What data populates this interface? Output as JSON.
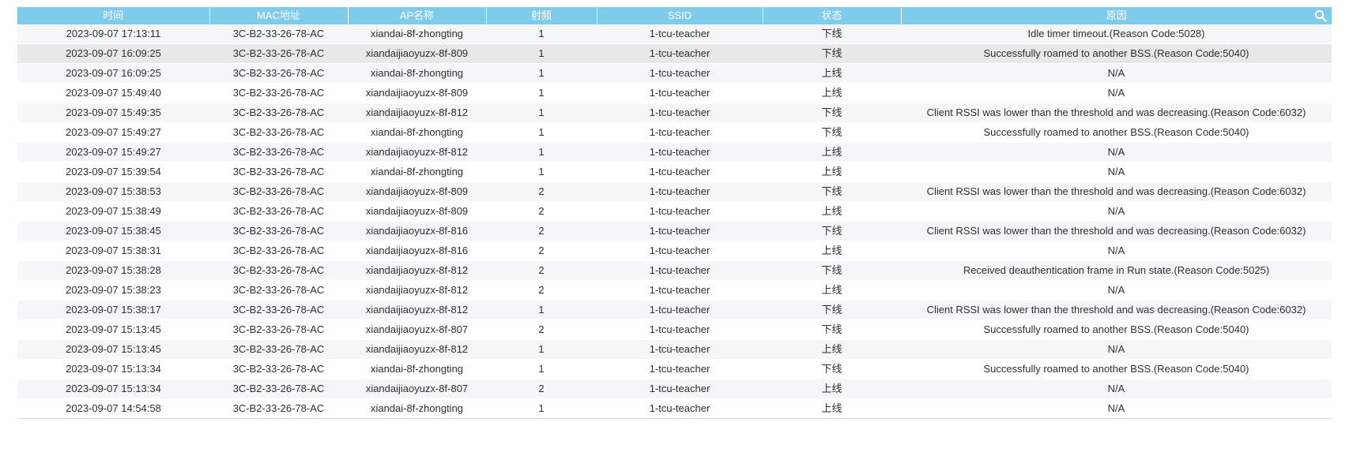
{
  "table": {
    "columns": [
      "时间",
      "MAC地址",
      "AP名称",
      "射频",
      "SSID",
      "状态",
      "原因"
    ],
    "search_icon": "search-icon",
    "rows": [
      [
        "2023-09-07 17:13:11",
        "3C-B2-33-26-78-AC",
        "xiandai-8f-zhongting",
        "1",
        "1-tcu-teacher",
        "下线",
        "Idle timer timeout.(Reason Code:5028)"
      ],
      [
        "2023-09-07 16:09:25",
        "3C-B2-33-26-78-AC",
        "xiandaijiaoyuzx-8f-809",
        "1",
        "1-tcu-teacher",
        "下线",
        "Successfully roamed to another BSS.(Reason Code:5040)"
      ],
      [
        "2023-09-07 16:09:25",
        "3C-B2-33-26-78-AC",
        "xiandai-8f-zhongting",
        "1",
        "1-tcu-teacher",
        "上线",
        "N/A"
      ],
      [
        "2023-09-07 15:49:40",
        "3C-B2-33-26-78-AC",
        "xiandaijiaoyuzx-8f-809",
        "1",
        "1-tcu-teacher",
        "上线",
        "N/A"
      ],
      [
        "2023-09-07 15:49:35",
        "3C-B2-33-26-78-AC",
        "xiandaijiaoyuzx-8f-812",
        "1",
        "1-tcu-teacher",
        "下线",
        "Client RSSI was lower than the threshold and was decreasing.(Reason Code:6032)"
      ],
      [
        "2023-09-07 15:49:27",
        "3C-B2-33-26-78-AC",
        "xiandai-8f-zhongting",
        "1",
        "1-tcu-teacher",
        "下线",
        "Successfully roamed to another BSS.(Reason Code:5040)"
      ],
      [
        "2023-09-07 15:49:27",
        "3C-B2-33-26-78-AC",
        "xiandaijiaoyuzx-8f-812",
        "1",
        "1-tcu-teacher",
        "上线",
        "N/A"
      ],
      [
        "2023-09-07 15:39:54",
        "3C-B2-33-26-78-AC",
        "xiandai-8f-zhongting",
        "1",
        "1-tcu-teacher",
        "上线",
        "N/A"
      ],
      [
        "2023-09-07 15:38:53",
        "3C-B2-33-26-78-AC",
        "xiandaijiaoyuzx-8f-809",
        "2",
        "1-tcu-teacher",
        "下线",
        "Client RSSI was lower than the threshold and was decreasing.(Reason Code:6032)"
      ],
      [
        "2023-09-07 15:38:49",
        "3C-B2-33-26-78-AC",
        "xiandaijiaoyuzx-8f-809",
        "2",
        "1-tcu-teacher",
        "上线",
        "N/A"
      ],
      [
        "2023-09-07 15:38:45",
        "3C-B2-33-26-78-AC",
        "xiandaijiaoyuzx-8f-816",
        "2",
        "1-tcu-teacher",
        "下线",
        "Client RSSI was lower than the threshold and was decreasing.(Reason Code:6032)"
      ],
      [
        "2023-09-07 15:38:31",
        "3C-B2-33-26-78-AC",
        "xiandaijiaoyuzx-8f-816",
        "2",
        "1-tcu-teacher",
        "上线",
        "N/A"
      ],
      [
        "2023-09-07 15:38:28",
        "3C-B2-33-26-78-AC",
        "xiandaijiaoyuzx-8f-812",
        "2",
        "1-tcu-teacher",
        "下线",
        "Received deauthentication frame in Run state.(Reason Code:5025)"
      ],
      [
        "2023-09-07 15:38:23",
        "3C-B2-33-26-78-AC",
        "xiandaijiaoyuzx-8f-812",
        "2",
        "1-tcu-teacher",
        "上线",
        "N/A"
      ],
      [
        "2023-09-07 15:38:17",
        "3C-B2-33-26-78-AC",
        "xiandaijiaoyuzx-8f-812",
        "1",
        "1-tcu-teacher",
        "下线",
        "Client RSSI was lower than the threshold and was decreasing.(Reason Code:6032)"
      ],
      [
        "2023-09-07 15:13:45",
        "3C-B2-33-26-78-AC",
        "xiandaijiaoyuzx-8f-807",
        "2",
        "1-tcu-teacher",
        "下线",
        "Successfully roamed to another BSS.(Reason Code:5040)"
      ],
      [
        "2023-09-07 15:13:45",
        "3C-B2-33-26-78-AC",
        "xiandaijiaoyuzx-8f-812",
        "1",
        "1-tcu-teacher",
        "上线",
        "N/A"
      ],
      [
        "2023-09-07 15:13:34",
        "3C-B2-33-26-78-AC",
        "xiandai-8f-zhongting",
        "1",
        "1-tcu-teacher",
        "下线",
        "Successfully roamed to another BSS.(Reason Code:5040)"
      ],
      [
        "2023-09-07 15:13:34",
        "3C-B2-33-26-78-AC",
        "xiandaijiaoyuzx-8f-807",
        "2",
        "1-tcu-teacher",
        "上线",
        "N/A"
      ],
      [
        "2023-09-07 14:54:58",
        "3C-B2-33-26-78-AC",
        "xiandai-8f-zhongting",
        "1",
        "1-tcu-teacher",
        "上线",
        "N/A"
      ]
    ],
    "highlighted_row": 1
  },
  "colors": {
    "header_bg": "#7fcbeb",
    "header_text": "#ffffff",
    "row_alt": "#f5f6f7",
    "row_highlight": "#e8e8e8"
  }
}
